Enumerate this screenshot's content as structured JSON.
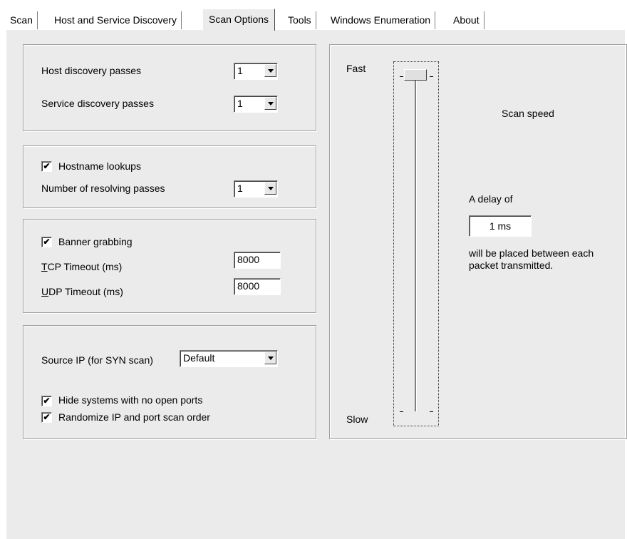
{
  "tabs": [
    {
      "label": "Scan"
    },
    {
      "label": "Host and Service Discovery"
    },
    {
      "label": "Scan Options",
      "active": true
    },
    {
      "label": "Tools"
    },
    {
      "label": "Windows Enumeration"
    },
    {
      "label": "About"
    }
  ],
  "discovery": {
    "host_label": "Host discovery passes",
    "host_value": "1",
    "service_label": "Service discovery passes",
    "service_value": "1"
  },
  "hostname": {
    "checkbox_label": "Hostname lookups",
    "checked": true,
    "resolving_label": "Number of resolving passes",
    "resolving_value": "1"
  },
  "banner": {
    "checkbox_label": "Banner grabbing",
    "checked": true,
    "tcp_label_u": "T",
    "tcp_label_rest": "CP Timeout (ms)",
    "tcp_value": "8000",
    "udp_label_u": "U",
    "udp_label_rest": "DP Timeout (ms)",
    "udp_value": "8000"
  },
  "source": {
    "label": "Source IP (for SYN scan)",
    "value": "Default",
    "hide_label": "Hide systems with no open ports",
    "hide_checked": true,
    "randomize_label": "Randomize IP and port scan order",
    "randomize_checked": true
  },
  "speed": {
    "fast_label": "Fast",
    "slow_label": "Slow",
    "title": "Scan speed",
    "delay_prefix": "A delay of",
    "delay_value": "1 ms",
    "delay_suffix": "will be placed between each packet transmitted.",
    "slider_position": 0
  },
  "check_glyph": "✔"
}
